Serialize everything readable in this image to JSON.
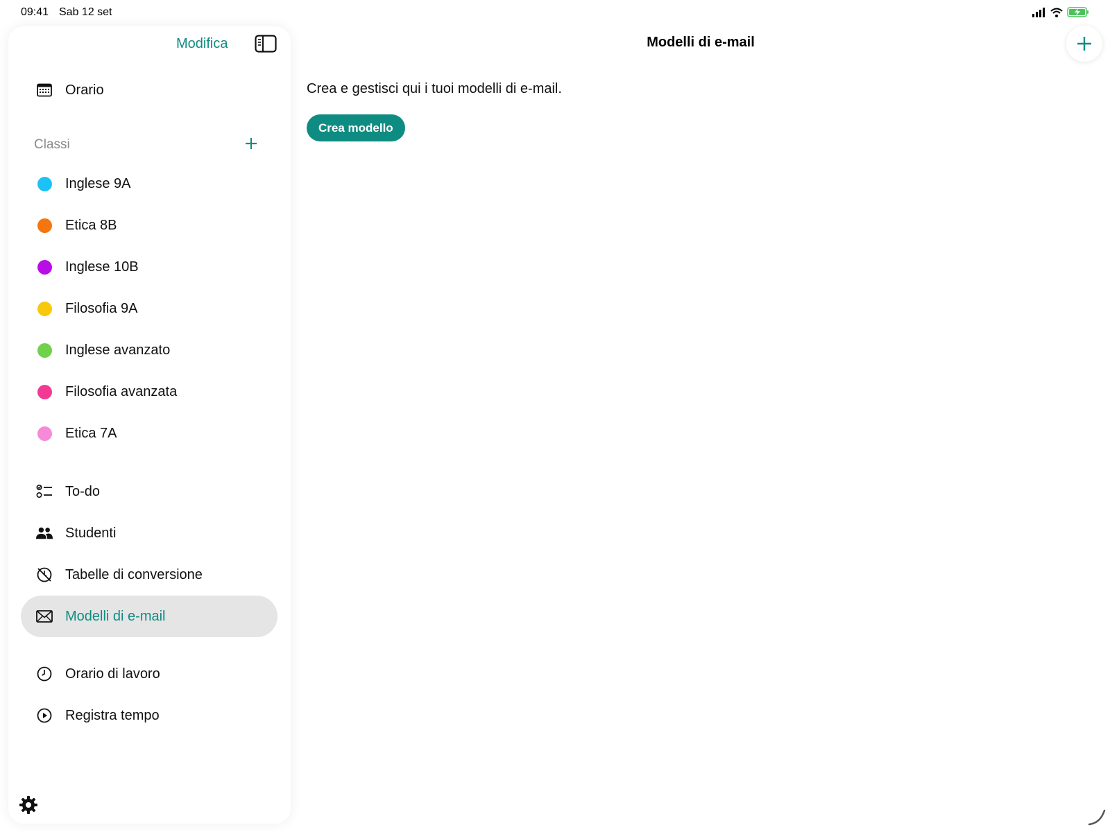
{
  "status_bar": {
    "time": "09:41",
    "date": "Sab 12 set",
    "icons": [
      "signal-icon",
      "wifi-icon",
      "battery-charging-icon"
    ]
  },
  "sidebar": {
    "edit_label": "Modifica",
    "toggle_icon": "sidebar-toggle-icon",
    "top_items": [
      {
        "label": "Orario",
        "icon": "calendar-icon"
      }
    ],
    "classes_section": {
      "label": "Classi",
      "add_icon": "plus-icon",
      "items": [
        {
          "label": "Inglese 9A",
          "color": "#1cc2f5"
        },
        {
          "label": "Etica 8B",
          "color": "#f5760f"
        },
        {
          "label": "Inglese 10B",
          "color": "#b80ee6"
        },
        {
          "label": "Filosofia 9A",
          "color": "#f8c80c"
        },
        {
          "label": "Inglese avanzato",
          "color": "#6fd24a"
        },
        {
          "label": "Filosofia avanzata",
          "color": "#f23a95"
        },
        {
          "label": "Etica 7A",
          "color": "#f78ad8"
        }
      ]
    },
    "tool_items": [
      {
        "label": "To-do",
        "icon": "checklist-icon"
      },
      {
        "label": "Studenti",
        "icon": "people-icon"
      },
      {
        "label": "Tabelle di conversione",
        "icon": "disabled-clock-icon"
      },
      {
        "label": "Modelli di e-mail",
        "icon": "envelope-icon",
        "active": true
      }
    ],
    "time_items": [
      {
        "label": "Orario di lavoro",
        "icon": "clock-icon"
      },
      {
        "label": "Registra tempo",
        "icon": "play-circle-icon"
      }
    ],
    "settings_icon": "gear-icon"
  },
  "main": {
    "title": "Modelli di e-mail",
    "add_icon": "plus-icon",
    "intro": "Crea e gestisci qui i tuoi modelli di e-mail.",
    "create_button_label": "Crea modello"
  },
  "colors": {
    "accent": "#0e8c82",
    "active_bg": "#e5e5e5",
    "section_label": "#8a8a8a"
  }
}
